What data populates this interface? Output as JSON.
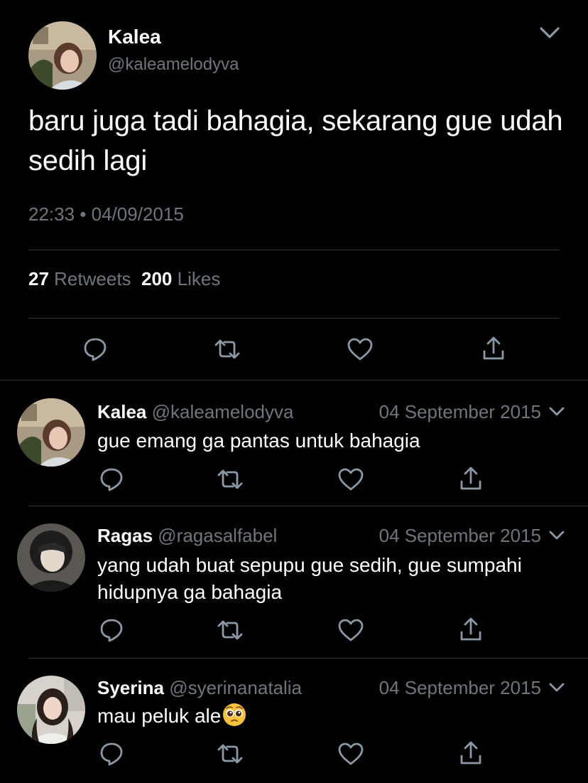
{
  "main_tweet": {
    "author_name": "Kalea",
    "author_handle": "@kaleamelodyva",
    "text": "baru juga tadi bahagia, sekarang gue udah sedih lagi",
    "time": "22:33",
    "separator": "•",
    "date": "04/09/2015",
    "retweets_count": "27",
    "retweets_label": "Retweets",
    "likes_count": "200",
    "likes_label": "Likes"
  },
  "icons": {
    "reply": "reply-icon",
    "retweet": "retweet-icon",
    "like": "heart-icon",
    "share": "share-icon",
    "more": "chevron-down-icon"
  },
  "replies": [
    {
      "name": "Kalea",
      "handle": "@kaleamelodyva",
      "date": "04 September 2015",
      "text": "gue emang ga pantas untuk bahagia"
    },
    {
      "name": "Ragas",
      "handle": "@ragasalfabel",
      "date": "04 September 2015",
      "text": "yang udah buat sepupu gue sedih, gue sumpahi hidupnya ga bahagia"
    },
    {
      "name": "Syerina",
      "handle": "@syerinanatalia",
      "date": "04 September 2015",
      "text": "mau peluk ale",
      "emoji": "🥺"
    }
  ],
  "colors": {
    "background": "#000000",
    "text_primary": "#ffffff",
    "text_secondary": "#6e767d",
    "divider": "#2f3336",
    "icon": "#8b98a5"
  }
}
